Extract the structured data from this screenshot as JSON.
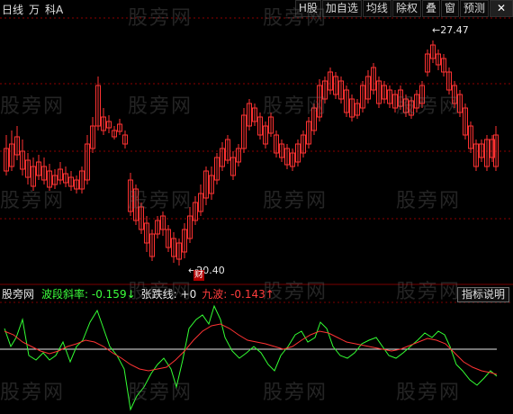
{
  "period_menu": [
    "日线",
    "万",
    "科A"
  ],
  "toolbar": {
    "buttons": [
      "H股",
      "加自选",
      "均线",
      "除权",
      "叠",
      "窗",
      "预测"
    ],
    "close_icon": "close-icon"
  },
  "watermark_text": "股旁网",
  "price_high": "27.47",
  "price_low": "20.40",
  "marker_text": "财",
  "indicator": {
    "name": "股旁网",
    "wave_label": "波段斜率",
    "wave_value": "-0.159",
    "wave_arrow": "↓",
    "zd_label": "张跌线",
    "zd_value": "+0",
    "jb_label": "九波",
    "jb_value": "-0.143",
    "jb_arrow": "↑",
    "help_button": "指标说明"
  },
  "colors": {
    "up": "#ff3232",
    "down": "#00e5e5",
    "grid": "#8b0000",
    "wave_line": "#33ff33",
    "jb_line": "#ff3333"
  }
}
